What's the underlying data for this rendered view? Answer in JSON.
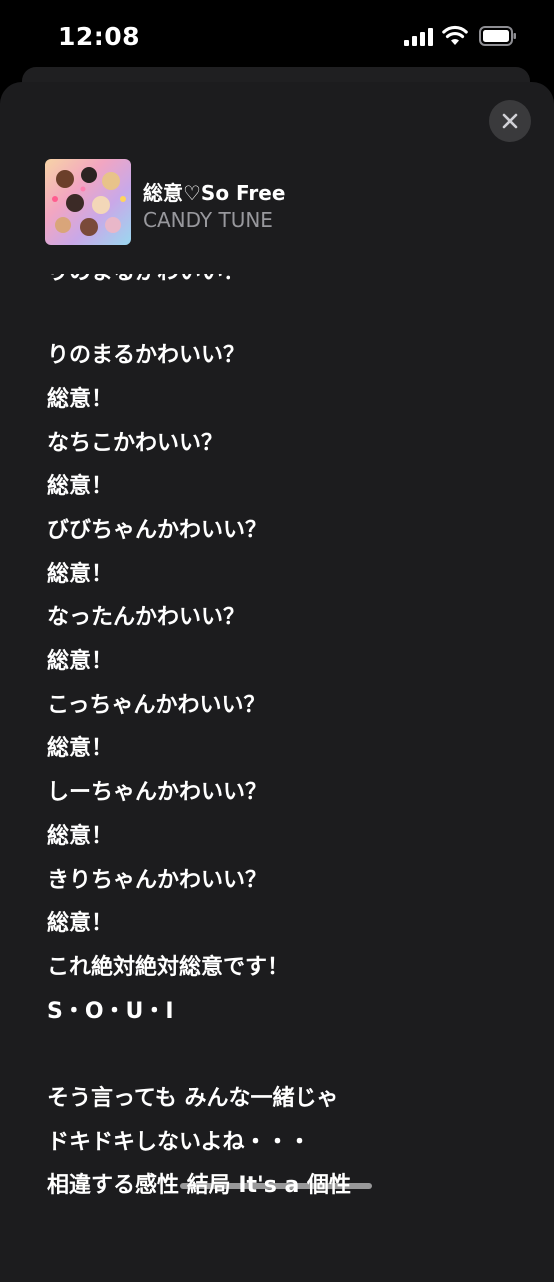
{
  "status_bar": {
    "time": "12:08",
    "icons": [
      "cellular-signal-icon",
      "wifi-icon",
      "battery-icon"
    ]
  },
  "player": {
    "close_icon": "close-icon",
    "song_title": "総意♡So Free",
    "artist": "CANDY TUNE",
    "artwork": "album-artwork"
  },
  "lyrics": {
    "lines": [
      "りのまるかわいい？",
      "総意！",
      "なちこかわいい？",
      "総意！",
      "びびちゃんかわいい？",
      "総意！",
      "なったんかわいい？",
      "総意！",
      "こっちゃんかわいい？",
      "総意！",
      "しーちゃんかわいい？",
      "総意！",
      "きりちゃんかわいい？",
      "総意！",
      "これ絶対絶対総意です！",
      "S・O・U・I",
      "そう言っても みんな一緒じゃ",
      "ドキドキしないよね・・・",
      "相違する感性 結局 It's a 個性"
    ]
  },
  "colors": {
    "background": "#000000",
    "sheet": "#1c1c1e",
    "secondary_text": "#98989d",
    "close_button": "#3a3a3c"
  }
}
